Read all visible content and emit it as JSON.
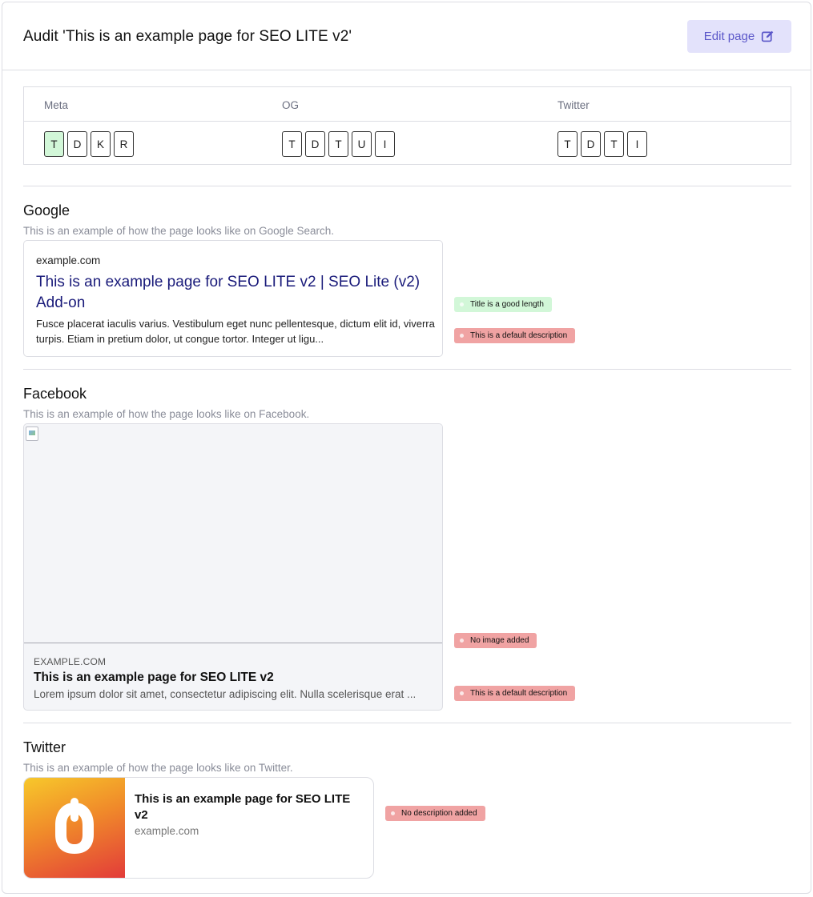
{
  "header": {
    "title": "Audit 'This is an example page for SEO LITE v2'",
    "edit_label": "Edit page",
    "edit_icon": "edit-square-icon",
    "accent_color": "#5b57c9"
  },
  "tag_table": {
    "columns": [
      "Meta",
      "OG",
      "Twitter"
    ],
    "meta_tags": [
      "T",
      "D",
      "K",
      "R"
    ],
    "og_tags": [
      "T",
      "D",
      "T",
      "U",
      "I"
    ],
    "twitter_tags": [
      "T",
      "D",
      "T",
      "I"
    ],
    "good_color": "#d2f7d8"
  },
  "google": {
    "title": "Google",
    "subtitle": "This is an example of how the page looks like on Google Search.",
    "url": "example.com",
    "page_title": "This is an example page for SEO LITE v2 | SEO Lite (v2) Add-on",
    "description": "Fusce placerat iaculis varius. Vestibulum eget nunc pellentesque, dictum elit id, viverra turpis. Etiam in pretium dolor, ut congue tortor. Integer ut ligu...",
    "badges": [
      "Title is a good length",
      "This is a default description"
    ]
  },
  "facebook": {
    "title": "Facebook",
    "subtitle": "This is an example of how the page looks like on Facebook.",
    "domain": "EXAMPLE.COM",
    "page_title": "This is an example page for SEO LITE v2",
    "description": "Lorem ipsum dolor sit amet, consectetur adipiscing elit. Nulla scelerisque erat ...",
    "badges": [
      "No image added",
      "This is a default description"
    ]
  },
  "twitter": {
    "title": "Twitter",
    "subtitle": "This is an example of how the page looks like on Twitter.",
    "page_title": "This is an example page for SEO LITE v2",
    "domain": "example.com",
    "badges": [
      "No description added"
    ]
  }
}
